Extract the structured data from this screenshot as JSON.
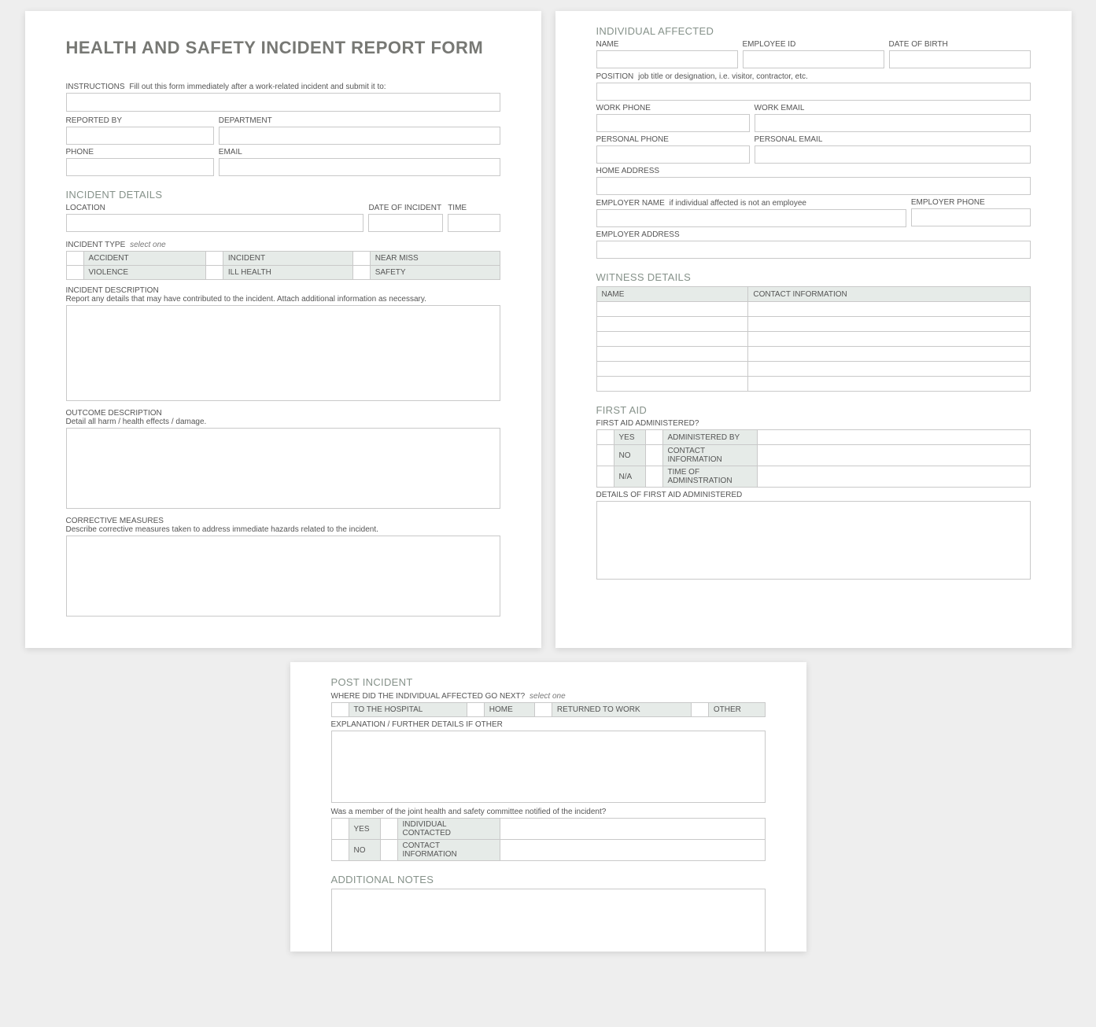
{
  "title": "HEALTH AND SAFETY INCIDENT REPORT FORM",
  "instructions": {
    "label": "INSTRUCTIONS",
    "text": "Fill out this form immediately after a work-related incident and submit it to:"
  },
  "reporter": {
    "reported_by": "REPORTED BY",
    "department": "DEPARTMENT",
    "phone": "PHONE",
    "email": "EMAIL"
  },
  "incident": {
    "heading": "INCIDENT DETAILS",
    "location": "LOCATION",
    "date": "DATE OF INCIDENT",
    "time": "TIME",
    "type_label": "INCIDENT TYPE",
    "select_one": "select one",
    "types": [
      "ACCIDENT",
      "INCIDENT",
      "NEAR MISS",
      "VIOLENCE",
      "ILL HEALTH",
      "SAFETY"
    ],
    "desc_label": "INCIDENT DESCRIPTION",
    "desc_sub": "Report any details that may have contributed to the incident.  Attach additional information as necessary.",
    "outcome_label": "OUTCOME DESCRIPTION",
    "outcome_sub": "Detail all harm / health effects / damage.",
    "corrective_label": "CORRECTIVE MEASURES",
    "corrective_sub": "Describe corrective measures taken to address immediate hazards related to the incident."
  },
  "individual": {
    "heading": "INDIVIDUAL AFFECTED",
    "name": "NAME",
    "empid": "EMPLOYEE ID",
    "dob": "DATE OF BIRTH",
    "position_label": "POSITION",
    "position_sub": "job title or designation, i.e. visitor, contractor, etc.",
    "workphone": "WORK PHONE",
    "workemail": "WORK EMAIL",
    "persphone": "PERSONAL PHONE",
    "persemail": "PERSONAL EMAIL",
    "homeaddr": "HOME ADDRESS",
    "emp_name_label": "EMPLOYER NAME",
    "emp_name_sub": "if individual affected is not an employee",
    "emp_phone": "EMPLOYER PHONE",
    "emp_addr": "EMPLOYER ADDRESS"
  },
  "witness": {
    "heading": "WITNESS DETAILS",
    "name": "NAME",
    "contact": "CONTACT INFORMATION"
  },
  "firstaid": {
    "heading": "FIRST AID",
    "q": "FIRST AID ADMINISTERED?",
    "yes": "YES",
    "no": "NO",
    "na": "N/A",
    "by": "ADMINISTERED BY",
    "contact": "CONTACT INFORMATION",
    "time": "TIME OF ADMINSTRATION",
    "details": "DETAILS OF FIRST AID ADMINISTERED"
  },
  "post": {
    "heading": "POST INCIDENT",
    "where_label": "WHERE DID THE INDIVIDUAL AFFECTED GO NEXT?",
    "select_one": "select one",
    "opts": [
      "TO THE HOSPITAL",
      "HOME",
      "RETURNED TO WORK",
      "OTHER"
    ],
    "explain": "EXPLANATION / FURTHER DETAILS IF OTHER",
    "committee": "Was a member of the joint health and safety committee notified of the incident?",
    "yes": "YES",
    "no": "NO",
    "ind": "INDIVIDUAL CONTACTED",
    "contact": "CONTACT INFORMATION"
  },
  "notes": {
    "heading": "ADDITIONAL NOTES"
  }
}
